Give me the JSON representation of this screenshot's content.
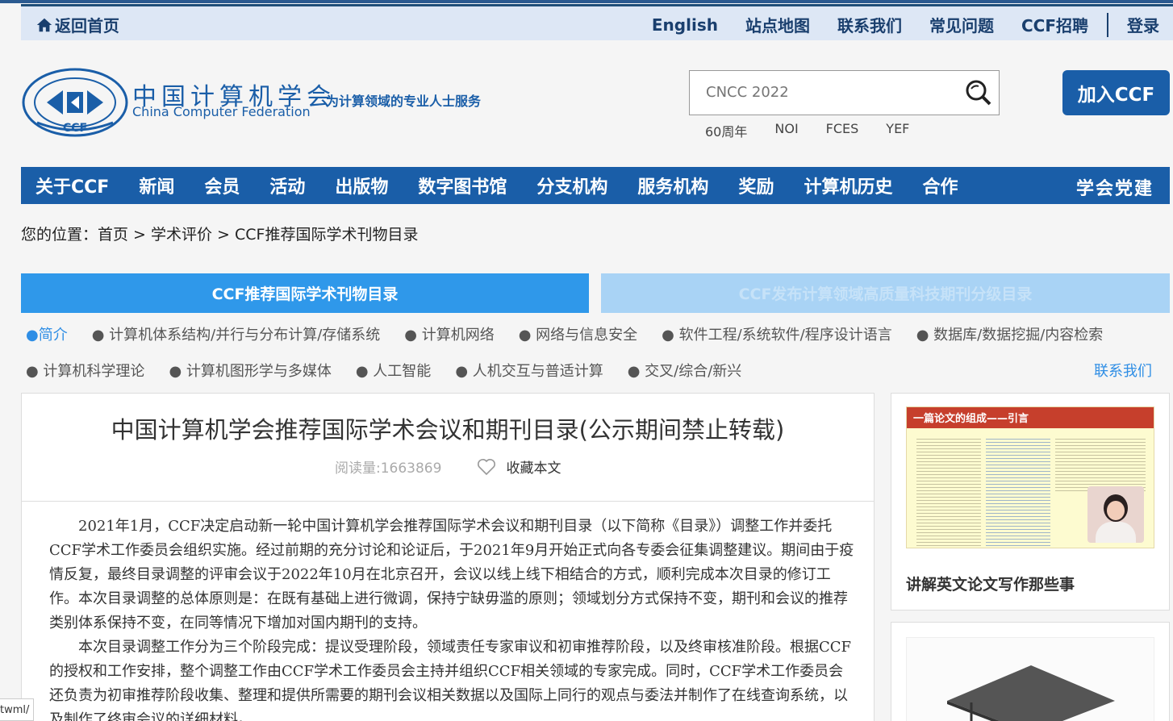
{
  "topbar": {
    "home_label": "返回首页",
    "links": [
      "English",
      "站点地图",
      "联系我们",
      "常见问题",
      "CCF招聘"
    ],
    "login": "登录"
  },
  "header": {
    "logo_cn": "中国计算机学会",
    "logo_en": "China Computer Federation",
    "slogan": "为计算领域的专业人士服务",
    "search_placeholder": "CNCC 2022",
    "quick_links": [
      "60周年",
      "NOI",
      "FCES",
      "YEF"
    ],
    "join_label": "加入CCF"
  },
  "nav": {
    "items": [
      "关于CCF",
      "新闻",
      "会员",
      "活动",
      "出版物",
      "数字图书馆",
      "分支机构",
      "服务机构",
      "奖励",
      "计算机历史",
      "合作"
    ],
    "party": "学会党建"
  },
  "breadcrumb": "您的位置：首页 > 学术评价 > CCF推荐国际学术刊物目录",
  "tabs": {
    "active": "CCF推荐国际学术刊物目录",
    "inactive": "CCF发布计算领域高质量科技期刊分级目录"
  },
  "categories_row1": [
    "●简介",
    "● 计算机体系结构/并行与分布计算/存储系统",
    "● 计算机网络",
    "● 网络与信息安全",
    "● 软件工程/系统软件/程序设计语言",
    "● 数据库/数据挖掘/内容检索"
  ],
  "categories_row2": [
    "● 计算机科学理论",
    "● 计算机图形学与多媒体",
    "● 人工智能",
    "● 人机交互与普适计算",
    "● 交叉/综合/新兴"
  ],
  "contact_us": "联系我们",
  "article": {
    "title": "中国计算机学会推荐国际学术会议和期刊目录(公示期间禁止转载)",
    "reads": "阅读量:1663869",
    "favorite": "收藏本文",
    "paragraph1": "2021年1月，CCF决定启动新一轮中国计算机学会推荐国际学术会议和期刊目录（以下简称《目录》）调整工作并委托CCF学术工作委员会组织实施。经过前期的充分讨论和论证后，于2021年9月开始正式向各专委会征集调整建议。期间由于疫情反复，最终目录调整的评审会议于2022年10月在北京召开，会议以线上线下相结合的方式，顺利完成本次目录的修订工作。本次目录调整的总体原则是：在既有基础上进行微调，保持宁缺毋滥的原则；领域划分方式保持不变，期刊和会议的推荐类别体系保持不变，在同等情况下增加对国内期刊的支持。",
    "paragraph2": "本次目录调整工作分为三个阶段完成：提议受理阶段，领域责任专家审议和初审推荐阶段，以及终审核准阶段。根据CCF的授权和工作安排，整个调整工作由CCF学术工作委员会主持并组织CCF相关领域的专家完成。同时，CCF学术工作委员会还负责为初审推荐阶段收集、整理和提供所需要的期刊会议相关数据以及国际上同行的观点与委法并制作了在线查询系统，以及制作了终审会议的详细材料。"
  },
  "sidebar": {
    "card1_banner": "一篇论文的组成——引言",
    "card1_title": "讲解英文论文写作那些事"
  },
  "url_fragment": "twml/"
}
